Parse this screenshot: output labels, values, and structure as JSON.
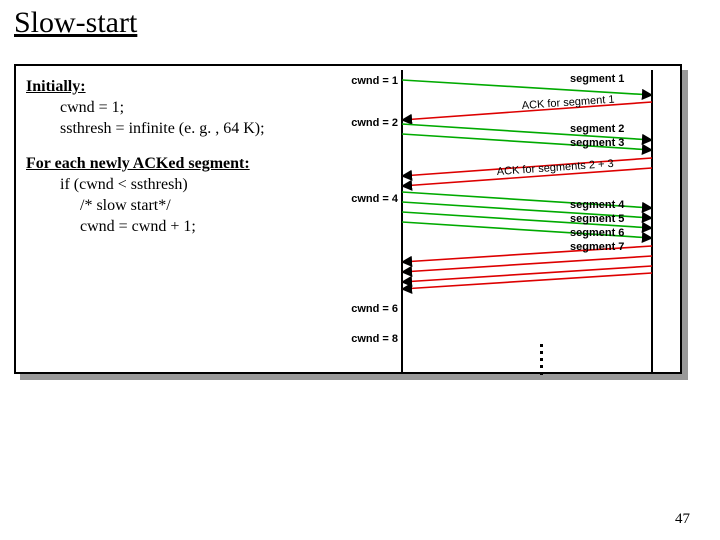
{
  "title": "Slow-start",
  "algo": {
    "init_label": "Initially:",
    "init_l1": "cwnd = 1;",
    "init_l2": "ssthresh = infinite (e. g. , 64 K);",
    "each_label": "For each newly ACKed segment:",
    "each_l1": "if (cwnd < ssthresh)",
    "each_l2": "/* slow start*/",
    "each_l3": "cwnd = cwnd + 1;"
  },
  "diag": {
    "cw1": "cwnd = 1",
    "cw2": "cwnd = 2",
    "cw4": "cwnd = 4",
    "cw6": "cwnd = 6",
    "cw8": "cwnd = 8",
    "seg1": "segment 1",
    "seg2": "segment 2",
    "seg3": "segment 3",
    "seg4": "segment 4",
    "seg5": "segment 5",
    "seg6": "segment 6",
    "seg7": "segment 7",
    "ack1": "ACK for segment 1",
    "ack23": "ACK for segments 2 + 3"
  },
  "slide_num": "47"
}
